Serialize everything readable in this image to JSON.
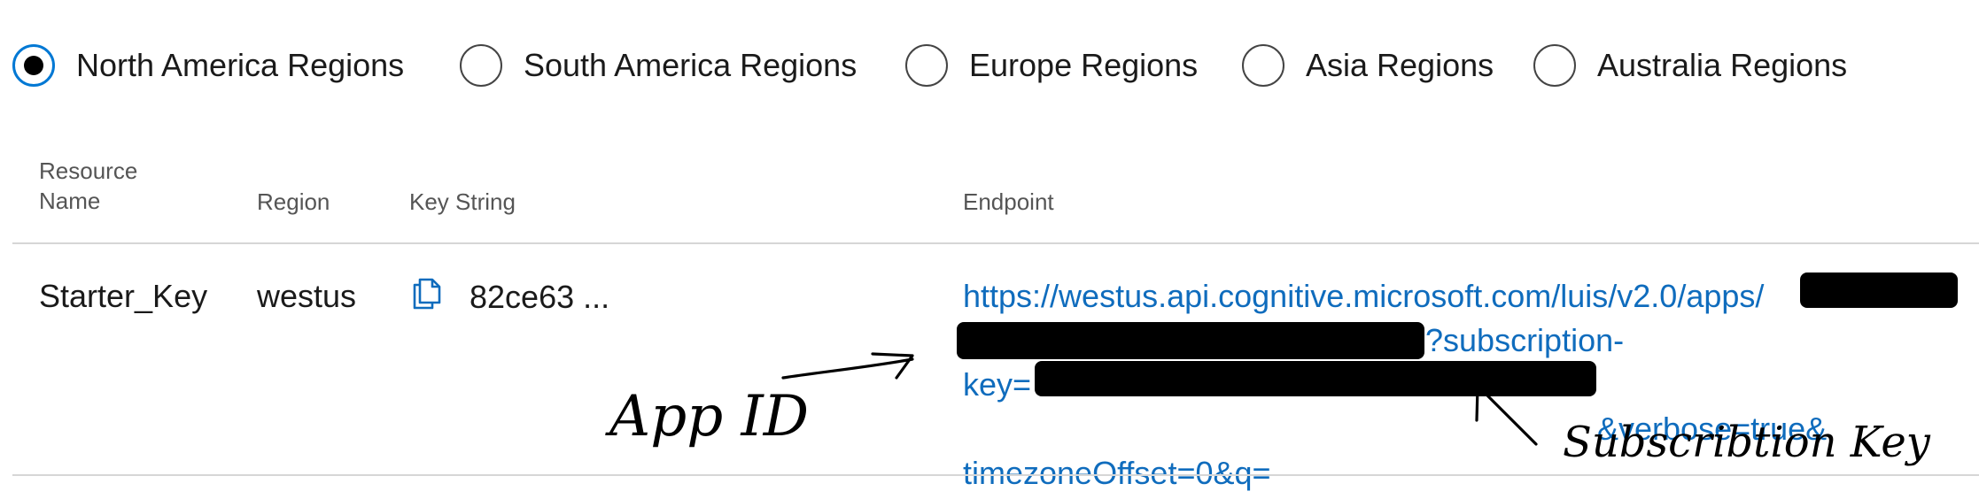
{
  "regions": {
    "options": [
      {
        "label": "North America Regions",
        "checked": true
      },
      {
        "label": "South America Regions",
        "checked": false
      },
      {
        "label": "Europe Regions",
        "checked": false
      },
      {
        "label": "Asia Regions",
        "checked": false
      },
      {
        "label": "Australia Regions",
        "checked": false
      }
    ]
  },
  "table": {
    "headers": {
      "resource_name_line1": "Resource",
      "resource_name_line2": "Name",
      "region": "Region",
      "key_string": "Key String",
      "endpoint": "Endpoint"
    },
    "row": {
      "resource_name": "Starter_Key",
      "region": "westus",
      "key_string": "82ce63 ...",
      "endpoint_lines": [
        "https://westus.api.cognitive.microsoft.com/luis/v2.0/apps/",
        "?subscription-",
        "key=",
        "&verbose=true&",
        "timezoneOffset=0&q="
      ]
    }
  },
  "annotations": {
    "app_id": "App ID",
    "subscription_key": "Subscribtion Key"
  },
  "colors": {
    "link": "#0f6cbd",
    "radio_accent": "#0078d4",
    "divider": "#d6d6d6",
    "redaction": "#000000"
  },
  "icons": {
    "copy": "copy-icon"
  }
}
